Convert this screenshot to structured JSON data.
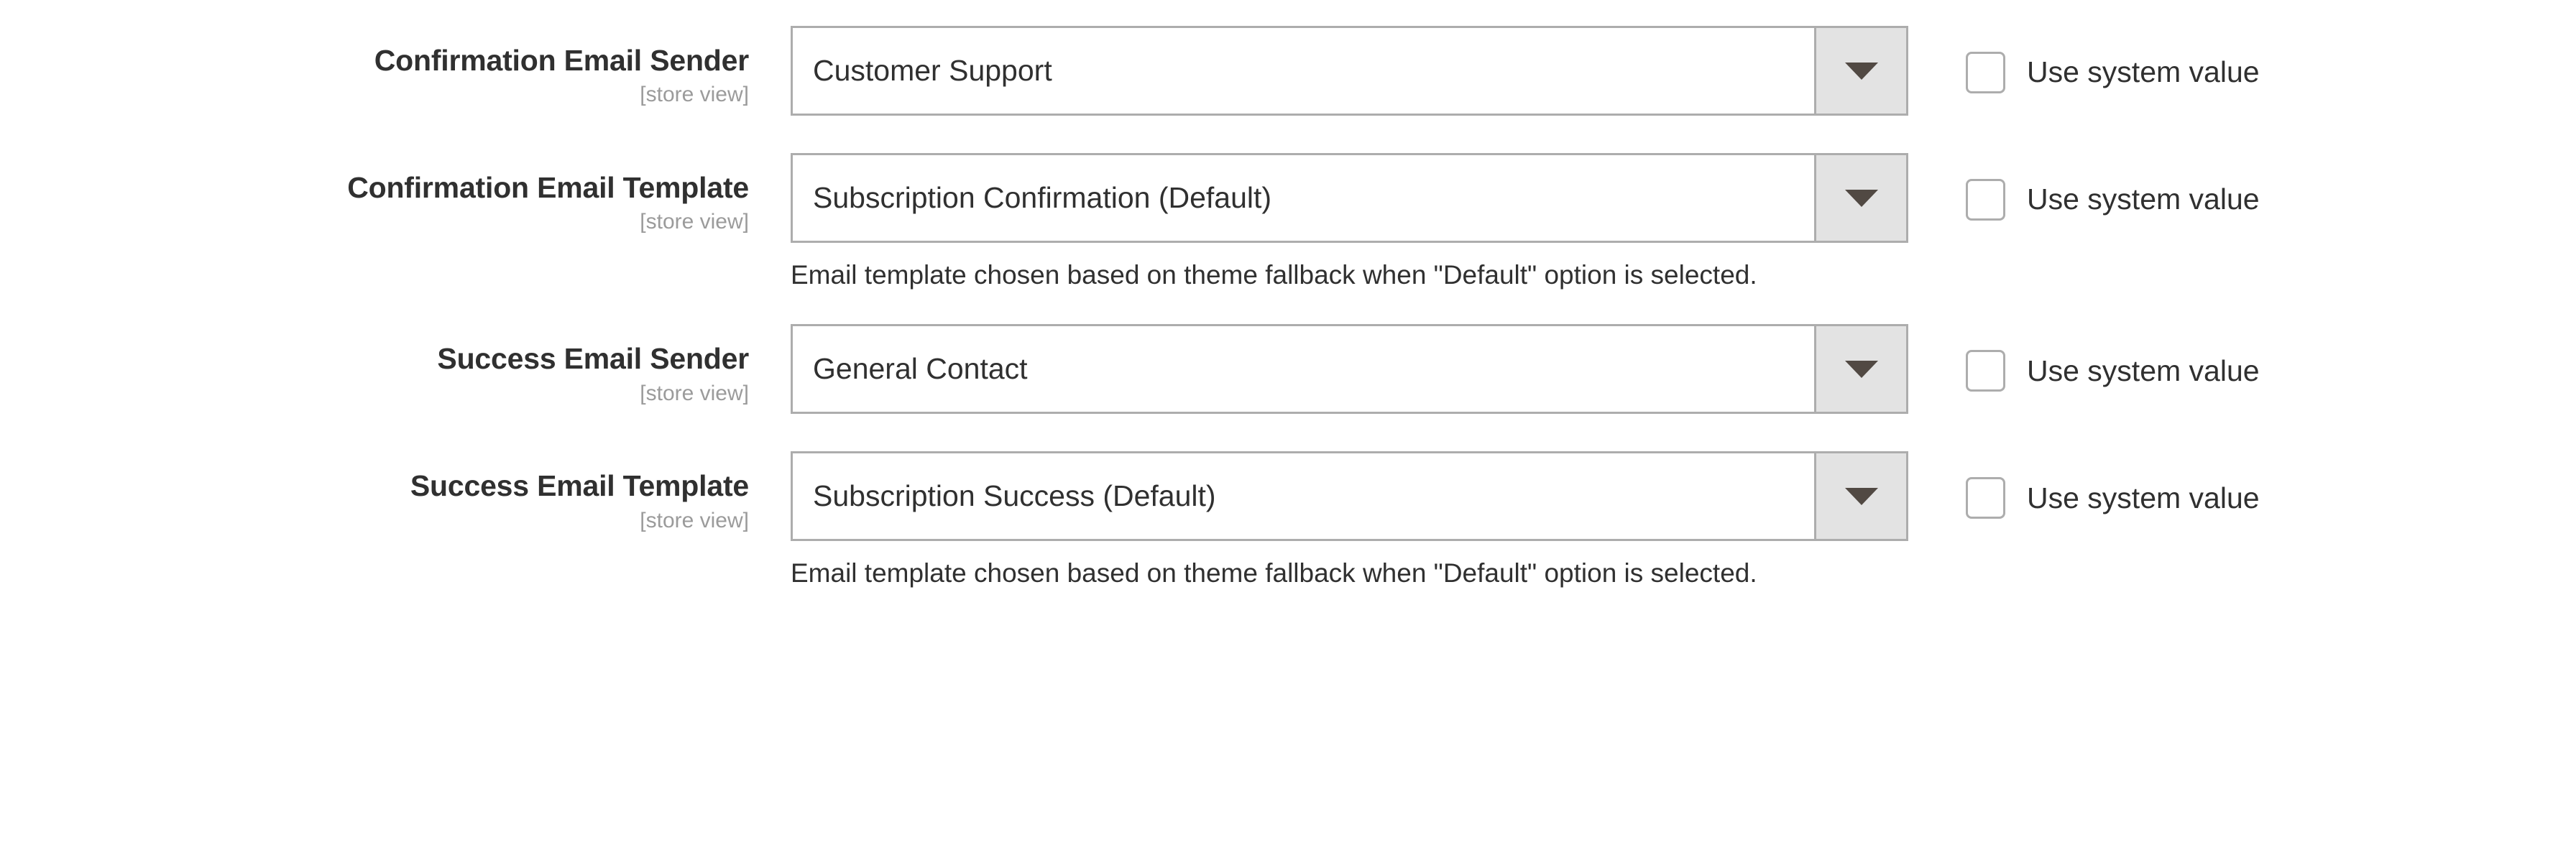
{
  "form": {
    "scope_note": "[store view]",
    "inherit_label": "Use system value",
    "caret_icon": "chevron-down-icon",
    "checkbox_icon": "unchecked-checkbox-icon",
    "colors": {
      "label_text": "#303030",
      "scope_text": "#9b9b9b",
      "field_border": "#adadad",
      "arrow_button_bg": "#e3e3e3",
      "caret": "#514943",
      "page_bg": "#ffffff"
    },
    "rows": [
      {
        "id": "confirmation_email_sender",
        "label": "Confirmation Email Sender",
        "scope": "[store view]",
        "value": "Customer Support",
        "note": "",
        "inherit_label": "Use system value",
        "inherit_checked": false
      },
      {
        "id": "confirmation_email_template",
        "label": "Confirmation Email Template",
        "scope": "[store view]",
        "value": "Subscription Confirmation (Default)",
        "note": "Email template chosen based on theme fallback when \"Default\" option is selected.",
        "inherit_label": "Use system value",
        "inherit_checked": false
      },
      {
        "id": "success_email_sender",
        "label": "Success Email Sender",
        "scope": "[store view]",
        "value": "General Contact",
        "note": "",
        "inherit_label": "Use system value",
        "inherit_checked": false
      },
      {
        "id": "success_email_template",
        "label": "Success Email Template",
        "scope": "[store view]",
        "value": "Subscription Success (Default)",
        "note": "Email template chosen based on theme fallback when \"Default\" option is selected.",
        "inherit_label": "Use system value",
        "inherit_checked": false
      }
    ]
  }
}
